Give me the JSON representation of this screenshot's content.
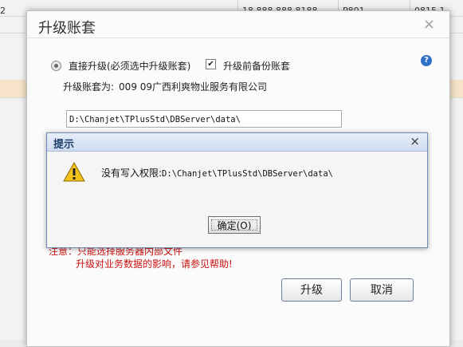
{
  "background": {
    "row_values": [
      "2",
      "18 888 888 8188",
      "P801",
      "0815 1"
    ]
  },
  "dialog": {
    "title": "升级账套",
    "close_glyph": "×",
    "option_direct_upgrade": "直接升级(必须选中升级账套)",
    "option_direct_upgrade_selected": true,
    "option_backup": "升级前备份账套",
    "option_backup_checked": true,
    "help_glyph": "?",
    "target_label": "升级账套为:",
    "target_value": "009 09广西利爽物业服务有限公司",
    "path_value": "D:\\Chanjet\\TPlusStd\\DBServer\\data\\",
    "note_line1": "注意：只能选择服务器内部文件",
    "note_line2": "升级对业务数据的影响，请参见帮助!",
    "upgrade_button": "升级",
    "cancel_button": "取消"
  },
  "alert": {
    "title": "提示",
    "close_glyph": "×",
    "message_label": "没有写入权限:",
    "message_path": "D:\\Chanjet\\TPlusStd\\DBServer\\data\\",
    "ok_button": "确定(O)"
  }
}
